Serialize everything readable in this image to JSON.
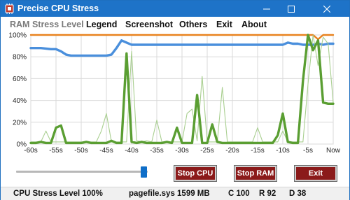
{
  "window": {
    "title": "Precise CPU Stress",
    "icon": "cpu-chip-icon",
    "controls": [
      "minimize-icon",
      "maximize-icon",
      "close-icon"
    ]
  },
  "menu": {
    "items": [
      "RAM Stress Level",
      "Legend",
      "Screenshot",
      "Others",
      "Exit",
      "About"
    ]
  },
  "chart_data": {
    "type": "line",
    "x_ticks": [
      "-60s",
      "-55s",
      "-50s",
      "-45s",
      "-40s",
      "-35s",
      "-30s",
      "-25s",
      "-20s",
      "-15s",
      "-10s",
      "-5s",
      "Now"
    ],
    "y_ticks": [
      "0%",
      "20%",
      "40%",
      "60%",
      "80%",
      "100%"
    ],
    "xlim": [
      -60,
      0
    ],
    "ylim": [
      0,
      100
    ],
    "grid": true,
    "series": [
      {
        "color": "#e8821e",
        "x": [
          -60,
          -5,
          -4,
          -3,
          -2,
          -1,
          0
        ],
        "y": [
          100,
          100,
          100,
          96,
          100,
          100,
          100
        ]
      },
      {
        "color": "#4a8fdc",
        "x": [
          -60,
          -58,
          -56,
          -55,
          -54,
          -53,
          -52,
          -50,
          -48,
          -46,
          -45,
          -44,
          -43,
          -42,
          -41,
          -40,
          -38,
          -36,
          -34,
          -32,
          -30,
          -28,
          -26,
          -24,
          -22,
          -20,
          -18,
          -16,
          -14,
          -12,
          -11,
          -10,
          -9,
          -8,
          -7,
          -6,
          -5,
          -4,
          -3,
          -2,
          -1,
          0
        ],
        "y": [
          88,
          88,
          87,
          87,
          85,
          82,
          81,
          81,
          81,
          81,
          81,
          82,
          88,
          95,
          93,
          91,
          91,
          91,
          91,
          91,
          91,
          91,
          91,
          91,
          91,
          91,
          91,
          91,
          91,
          91,
          91,
          91,
          93,
          92,
          92,
          91,
          91,
          91,
          92,
          91,
          92,
          92
        ]
      },
      {
        "color": "#a9cf90",
        "x": [
          -60,
          -58,
          -57,
          -56,
          -55,
          -54,
          -53,
          -52,
          -51,
          -50,
          -49,
          -48,
          -47,
          -46,
          -45,
          -44,
          -43,
          -42,
          -41,
          -40,
          -39,
          -38,
          -37,
          -36,
          -35,
          -34,
          -33,
          -32,
          -31,
          -30,
          -29,
          -28,
          -27,
          -26,
          -25,
          -24,
          -23,
          -22,
          -21,
          -20,
          -19,
          -18,
          -17,
          -16,
          -15,
          -14,
          -13,
          -12,
          -11,
          -10,
          -9,
          -8,
          -7,
          -6,
          -5,
          -4,
          -3,
          -2,
          -1,
          0
        ],
        "y": [
          2,
          2,
          12,
          2,
          2,
          2,
          2,
          2,
          2,
          2,
          2,
          2,
          2,
          12,
          28,
          2,
          2,
          2,
          2,
          85,
          3,
          2,
          3,
          2,
          22,
          2,
          2,
          2,
          2,
          2,
          28,
          32,
          3,
          62,
          2,
          2,
          2,
          52,
          2,
          2,
          2,
          2,
          2,
          2,
          15,
          2,
          2,
          2,
          2,
          12,
          2,
          2,
          2,
          2,
          55,
          100,
          72,
          98,
          92,
          38
        ]
      },
      {
        "color": "#5a9e32",
        "x": [
          -60,
          -59,
          -58,
          -57,
          -56,
          -55,
          -54,
          -53,
          -52,
          -51,
          -50,
          -49,
          -48,
          -47,
          -46,
          -45,
          -44,
          -43,
          -42,
          -41,
          -40,
          -39,
          -38,
          -37,
          -36,
          -35,
          -34,
          -33,
          -32,
          -31,
          -30,
          -29,
          -28,
          -27,
          -26,
          -25,
          -24,
          -23,
          -22,
          -21,
          -20,
          -19,
          -18,
          -17,
          -16,
          -15,
          -14,
          -13,
          -12,
          -11,
          -10,
          -9,
          -8,
          -7,
          -6,
          -5,
          -4,
          -3,
          -2,
          -1,
          0
        ],
        "y": [
          1,
          1,
          2,
          1,
          1,
          15,
          17,
          1,
          1,
          1,
          1,
          2,
          1,
          1,
          1,
          1,
          3,
          1,
          1,
          83,
          2,
          1,
          2,
          1,
          1,
          1,
          1,
          2,
          1,
          15,
          1,
          1,
          1,
          45,
          1,
          1,
          18,
          2,
          1,
          1,
          1,
          1,
          1,
          1,
          1,
          1,
          1,
          1,
          1,
          8,
          28,
          2,
          1,
          1,
          58,
          100,
          86,
          95,
          38,
          37,
          37
        ]
      }
    ]
  },
  "controls": {
    "slider_value": 100,
    "stop_cpu": "Stop CPU",
    "stop_ram": "Stop RAM",
    "exit": "Exit"
  },
  "status": {
    "cpu_level": "CPU Stress Level 100%",
    "pagefile": "pagefile.sys 1599 MB",
    "c": "C 100",
    "r": "R 92",
    "d": "D 38"
  }
}
